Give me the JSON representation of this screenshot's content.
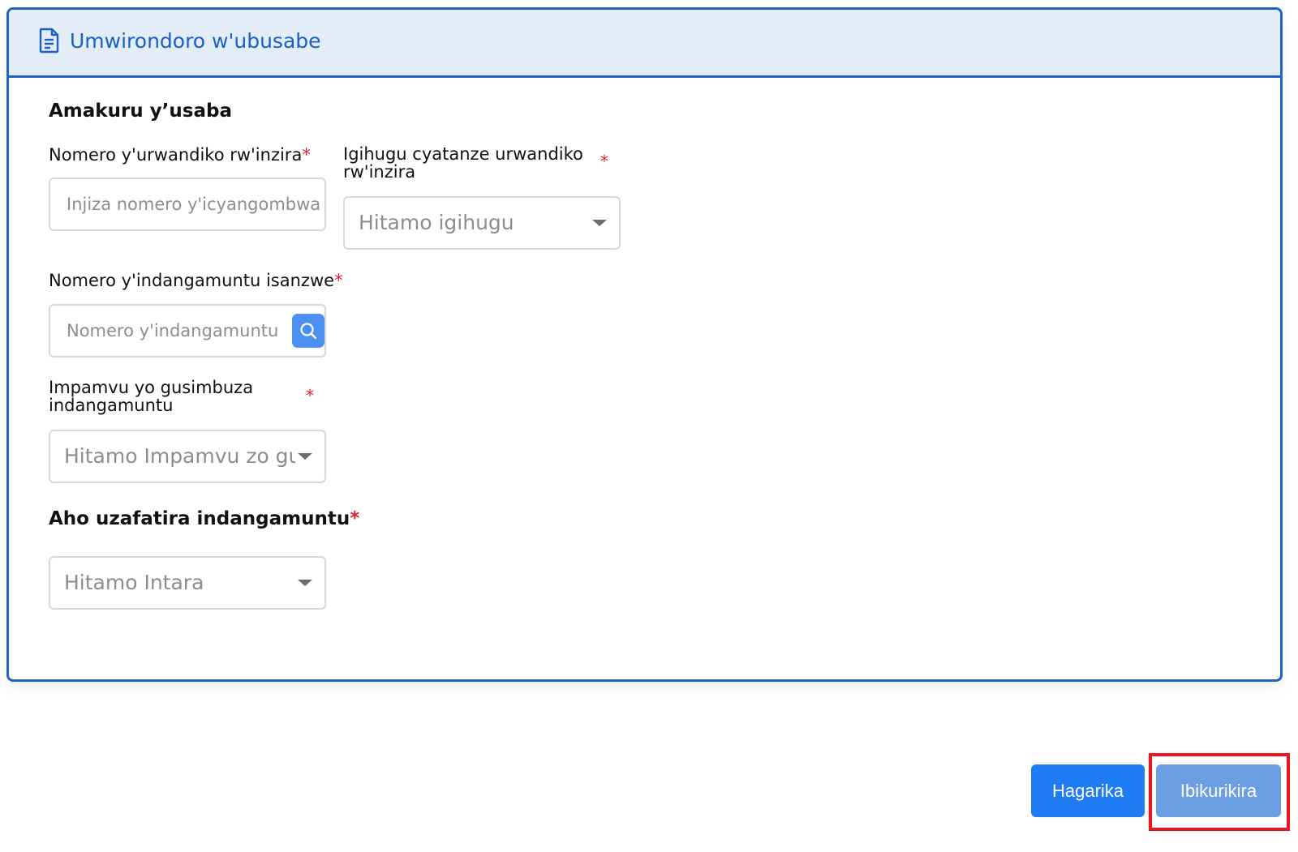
{
  "card": {
    "title": "Umwirondoro w'ubusabe",
    "icon": "document-icon"
  },
  "section": {
    "title": "Amakuru y’usaba"
  },
  "fields": {
    "passport_number": {
      "label": "Nomero y'urwandiko rw'inzira",
      "required_mark": "*",
      "placeholder": "Injiza nomero y'icyangombwa"
    },
    "issuing_country": {
      "label": "Igihugu cyatanze urwandiko rw'inzira",
      "required_mark": "*",
      "placeholder": "Hitamo igihugu"
    },
    "existing_id": {
      "label": "Nomero y'indangamuntu isanzwe",
      "required_mark": "*",
      "placeholder": "Nomero y'indangamuntu i"
    },
    "replacement_reason": {
      "label": "Impamvu yo gusimbuza indangamuntu",
      "required_mark": "*",
      "placeholder": "Hitamo Impamvu zo gus"
    }
  },
  "pickup": {
    "title": "Aho uzafatira indangamuntu",
    "required_mark": "*",
    "placeholder": "Hitamo Intara"
  },
  "buttons": {
    "cancel": "Hagarika",
    "next": "Ibikurikira"
  },
  "colors": {
    "accent": "#1f63c4",
    "header_bg": "#e3edf8",
    "primary_button": "#1f7cf3",
    "next_button": "#6b9ee3",
    "required": "#e0232f",
    "highlight": "#f0141e"
  }
}
